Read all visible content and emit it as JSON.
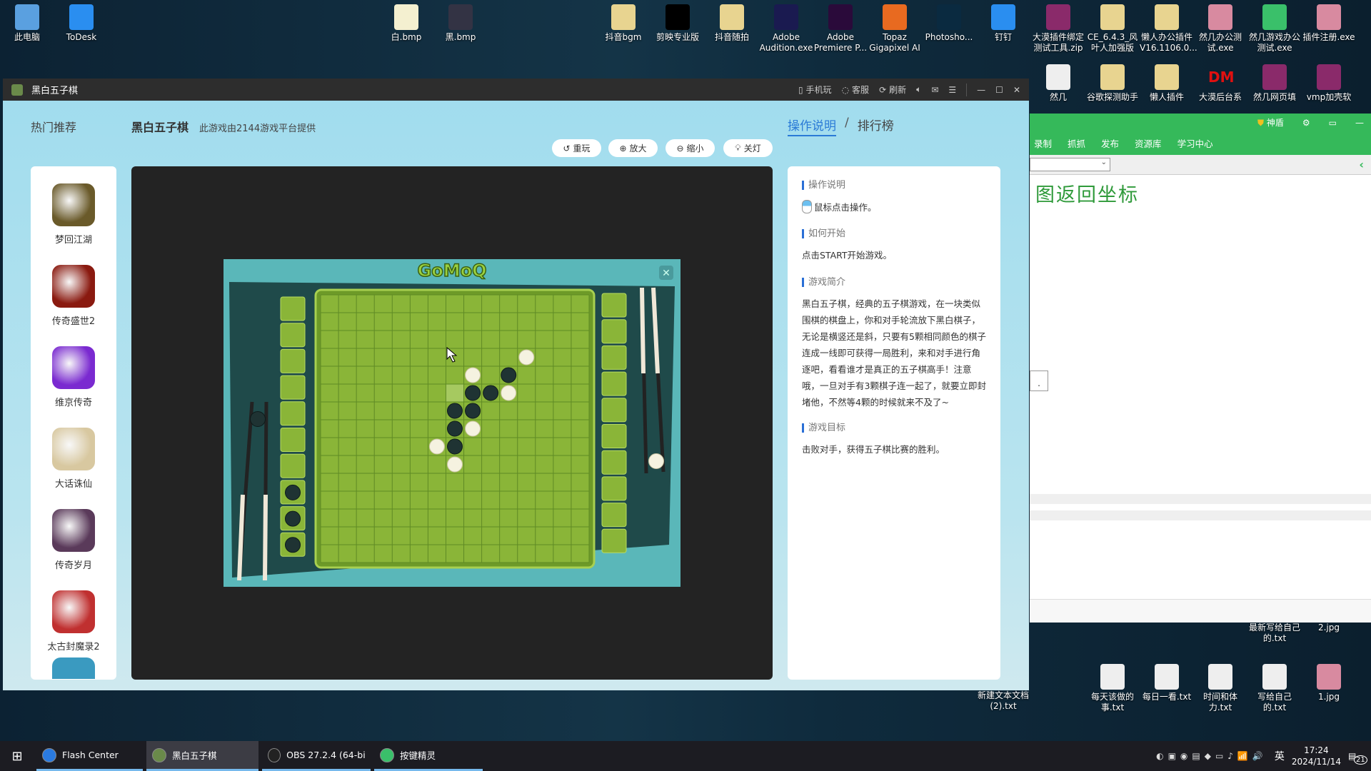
{
  "desktop": {
    "top_icons": [
      {
        "label": "此电脑",
        "color": "#5aa0e0"
      },
      {
        "label": "ToDesk",
        "color": "#2a8ef0"
      },
      {
        "label": "白.bmp",
        "color": "#f4f0d0"
      },
      {
        "label": "黑.bmp",
        "color": "#334"
      },
      {
        "label": "抖音bgm",
        "color": "#e8d490"
      },
      {
        "label": "剪映专业版",
        "color": "#000"
      },
      {
        "label": "抖音随拍",
        "color": "#e8d490"
      },
      {
        "label": "Adobe Audition.exe",
        "color": "#1a1a50"
      },
      {
        "label": "Adobe Premiere P...",
        "color": "#2a0a3a"
      },
      {
        "label": "Topaz Gigapixel AI",
        "color": "#e86a20"
      },
      {
        "label": "Photosho...",
        "color": "#0a2a40"
      },
      {
        "label": "钉钉",
        "color": "#2a8ef0"
      },
      {
        "label": "大漠插件绑定测试工具.zip",
        "color": "#8a2a6a"
      },
      {
        "label": "CE_6.4.3_风叶人加强版",
        "color": "#e8d490"
      },
      {
        "label": "懒人办公插件V16.1106.0...",
        "color": "#e8d490"
      },
      {
        "label": "然几办公测试.exe",
        "color": "#d88aa0"
      },
      {
        "label": "然几游戏办公测试.exe",
        "color": "#3ac06a"
      },
      {
        "label": "插件注册.exe",
        "color": "#d88aa0"
      }
    ],
    "second_icons": [
      {
        "label": "然几",
        "color": "#eee"
      },
      {
        "label": "谷歌探测助手",
        "color": "#e8d490"
      },
      {
        "label": "懒人插件",
        "color": "#e8d490"
      },
      {
        "label": "大漠后台系",
        "color": "#0000"
      },
      {
        "label": "然几网页填",
        "color": "#8a2a6a"
      },
      {
        "label": "vmp加壳软",
        "color": "#8a2a6a"
      }
    ],
    "bottom_icons": [
      {
        "label": "最新写给自己的.txt",
        "color": "#eee"
      },
      {
        "label": "2.jpg",
        "color": "#555"
      },
      {
        "label": "每天该做的事.txt",
        "color": "#eee"
      },
      {
        "label": "每日一看.txt",
        "color": "#eee"
      },
      {
        "label": "时间和体力.txt",
        "color": "#eee"
      },
      {
        "label": "写给自己的.txt",
        "color": "#eee"
      },
      {
        "label": "1.jpg",
        "color": "#d88aa0"
      },
      {
        "label": "新建文本文档(2).txt",
        "color": ""
      }
    ],
    "dm_text": "DM"
  },
  "window": {
    "title": "黑白五子棋",
    "actions": {
      "mobile": "手机玩",
      "service": "客服",
      "refresh": "刷新"
    },
    "hot_label": "热门推荐",
    "game_title": "黑白五子棋",
    "game_subtitle": "此游戏由2144游戏平台提供",
    "buttons": {
      "replay": "重玩",
      "zoom_in": "放大",
      "zoom_out": "缩小",
      "lights_off": "关灯"
    },
    "tabs": {
      "active": "操作说明",
      "sep": "/",
      "other": "排行榜"
    },
    "sidebar_games": [
      {
        "name": "梦回江湖",
        "color": "#6a5a2a"
      },
      {
        "name": "传奇盛世2",
        "color": "#8a1a10"
      },
      {
        "name": "维京传奇",
        "color": "#7a2ad0"
      },
      {
        "name": "大话诛仙",
        "color": "#d8c8a0"
      },
      {
        "name": "传奇岁月",
        "color": "#5a3a5a"
      },
      {
        "name": "太古封魔录2",
        "color": "#c03030"
      }
    ],
    "panel": {
      "h1": "操作说明",
      "t1": "鼠标点击操作。",
      "h2": "如何开始",
      "t2": "点击START开始游戏。",
      "h3": "游戏简介",
      "t3": "黑白五子棋，经典的五子棋游戏，在一块类似围棋的棋盘上，你和对手轮流放下黑白棋子，无论是横竖还是斜，只要有5颗相同颜色的棋子连成一线即可获得一局胜利，来和对手进行角逐吧，看看谁才是真正的五子棋高手！注意哦，一旦对手有3颗棋子连一起了，就要立即封堵他，不然等4颗的时候就来不及了~",
      "h4": "游戏目标",
      "t4": "击败对手，获得五子棋比赛的胜利。"
    }
  },
  "board": {
    "logo": "GoMoQ",
    "cols": 15,
    "rows": 15,
    "highlight": {
      "col": 7,
      "row": 5
    },
    "stones": [
      {
        "col": 11,
        "row": 3,
        "color": "white"
      },
      {
        "col": 8,
        "row": 4,
        "color": "white"
      },
      {
        "col": 10,
        "row": 4,
        "color": "black"
      },
      {
        "col": 8,
        "row": 5,
        "color": "black"
      },
      {
        "col": 9,
        "row": 5,
        "color": "black"
      },
      {
        "col": 10,
        "row": 5,
        "color": "white"
      },
      {
        "col": 7,
        "row": 6,
        "color": "black"
      },
      {
        "col": 8,
        "row": 6,
        "color": "black"
      },
      {
        "col": 7,
        "row": 7,
        "color": "black"
      },
      {
        "col": 8,
        "row": 7,
        "color": "white"
      },
      {
        "col": 6,
        "row": 8,
        "color": "white"
      },
      {
        "col": 7,
        "row": 8,
        "color": "black"
      },
      {
        "col": 7,
        "row": 9,
        "color": "white"
      }
    ],
    "left_tray": {
      "slots": 10,
      "captured_black": 3
    },
    "right_tray": {
      "slots": 10,
      "captured_white": 0
    }
  },
  "side_app": {
    "shield": "神盾",
    "toolbar": [
      "录制",
      "抓抓",
      "发布",
      "资源库",
      "学习中心"
    ],
    "heading": "图返回坐标",
    "box_text": "."
  },
  "taskbar": {
    "items": [
      {
        "label": "Flash Center",
        "color": "#2a7ae0"
      },
      {
        "label": "黑白五子棋",
        "color": "#6a8a4a"
      },
      {
        "label": "OBS 27.2.4 (64-bi...",
        "color": "#222"
      },
      {
        "label": "按键精灵",
        "color": "#3ac06a"
      }
    ],
    "ime": "英",
    "time": "17:24",
    "date": "2024/11/14",
    "notifications": "21"
  }
}
